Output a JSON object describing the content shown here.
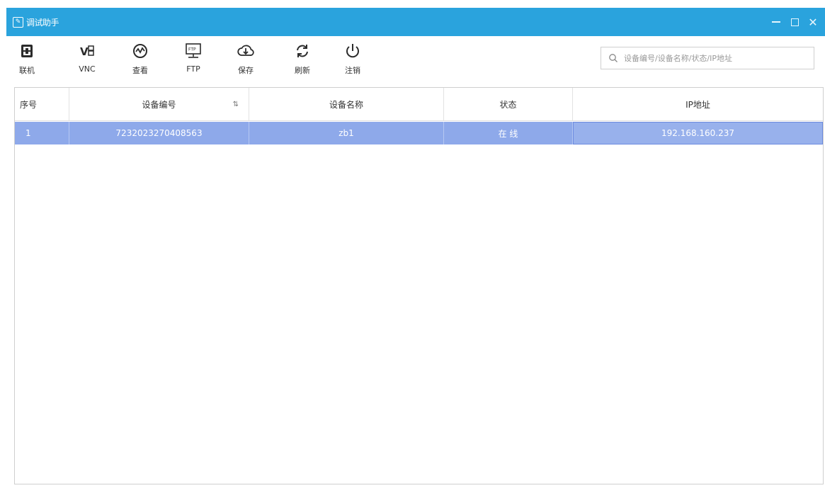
{
  "window": {
    "title": "调试助手",
    "title_bar_color": "#2aa3dd"
  },
  "toolbar": {
    "items": [
      {
        "label": "联机",
        "icon": "connect-icon"
      },
      {
        "label": "VNC",
        "icon": "vnc-icon"
      },
      {
        "label": "查看",
        "icon": "monitor-icon"
      },
      {
        "label": "FTP",
        "icon": "ftp-icon"
      },
      {
        "label": "保存",
        "icon": "download-icon"
      },
      {
        "label": "刷新",
        "icon": "refresh-icon"
      },
      {
        "label": "注销",
        "icon": "power-icon"
      }
    ]
  },
  "search": {
    "placeholder": "设备编号/设备名称/状态/IP地址"
  },
  "table": {
    "columns": [
      "序号",
      "设备编号",
      "设备名称",
      "状态",
      "IP地址"
    ],
    "sort_indicator": "⇅",
    "rows": [
      {
        "index": "1",
        "device_id": "723202327040856​3",
        "device_name": "zb1",
        "status": "在 线",
        "ip": "192.168.160.237"
      }
    ],
    "selected_row_color": "#8ea9ea"
  }
}
